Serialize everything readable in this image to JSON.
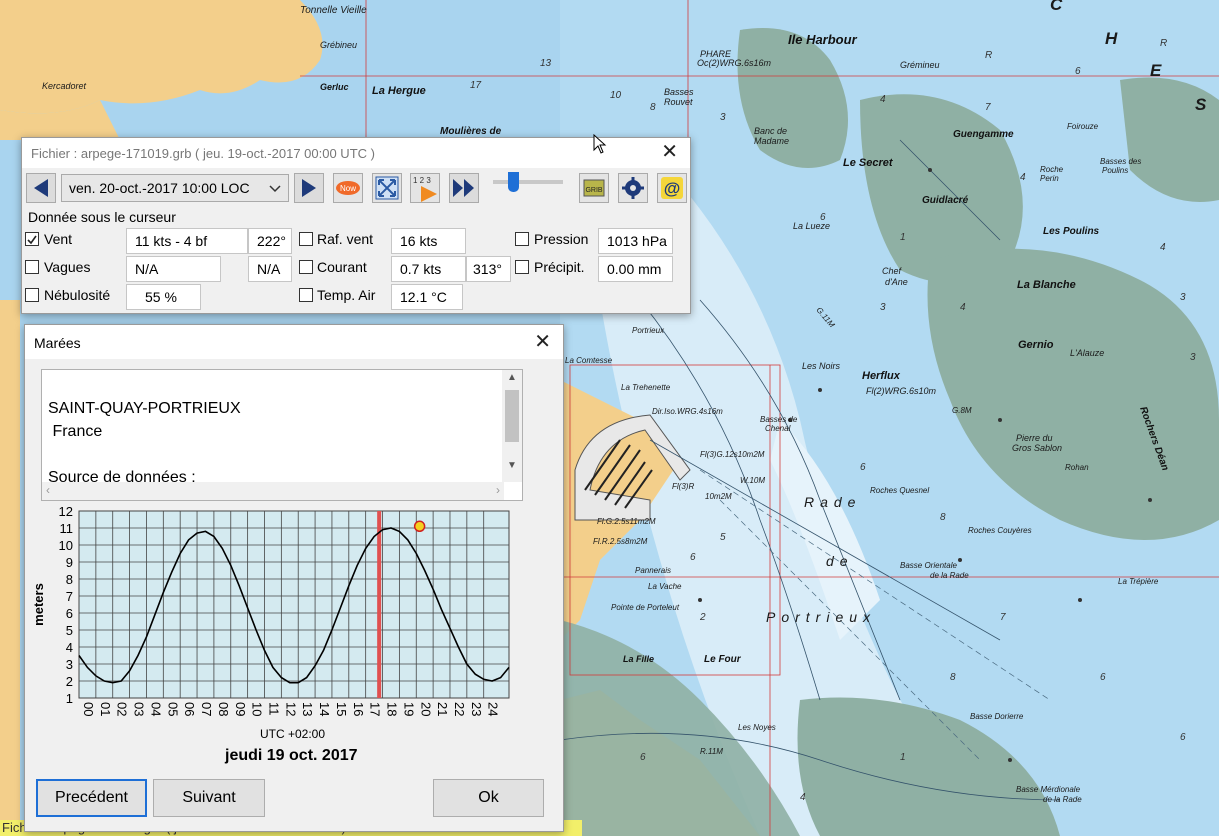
{
  "map": {
    "labels": [
      "Tonnelle Vieille",
      "Grébineu",
      "Kercadoret",
      "La Hergue",
      "Moulières de",
      "Ile Harbour",
      "PHARE",
      "Oc(2)WRG.6s16m",
      "Basses",
      "Rouvet",
      "Grémineu",
      "Banc de",
      "Madame",
      "Le Secret",
      "Guengamme",
      "Guidlacré",
      "Basses des",
      "Poulins",
      "Roche",
      "Perin",
      "La Lueze",
      "Les Poulins",
      "Chef",
      "d'Ane",
      "La Blanche",
      "Gernio",
      "L'Alauze",
      "Les Noirs",
      "Herflux",
      "Fl(2)WRG.6s10m",
      "Pierre du",
      "Gros Sablon",
      "Rohan",
      "Rochers Déan",
      "Basses de",
      "Chenal",
      "La Trehenette",
      "Dir.Iso.WRG.4s16m",
      "Fl(3)G.12s10m2M",
      "Fl(3)R",
      "10m2M",
      "Fl.G.2.5s11m2M",
      "Fl.R.2.5s8m2M",
      "Pannerais",
      "La Vache",
      "Pointe de Porteleut",
      "Rade",
      "de",
      "Portrieux",
      "Roches Quesnel",
      "Roches Couyères",
      "Basse Orientale",
      "de la Rade",
      "La Trépière",
      "La Fille",
      "Le Four",
      "Basse Dorierre",
      "Les Noyes",
      "Basse Mérdionale",
      "de la Rade",
      "Portrieux",
      "La Comtesse",
      "Gerluc",
      "Foirouze",
      "W.10M",
      "R.11M",
      "G.8M",
      "G.11M"
    ]
  },
  "statusbar": {
    "text": "Fichier : arpege-171019.grb ( jeu. 19-oct.-2017 00:00  UTC )"
  },
  "data_window": {
    "title": "Fichier : arpege-171019.grb ( jeu. 19-oct.-2017 00:00  UTC )",
    "date_select": "ven. 20-oct.-2017  10:00 LOC",
    "now_icon_text": "Now",
    "count_icon_text": "1 2 3",
    "slider_value": 0.08,
    "section_label": "Donnée sous le curseur",
    "rows": {
      "vent": {
        "label": "Vent",
        "checked": true,
        "value": "11 kts -  4 bf",
        "dir": "222°"
      },
      "vagues": {
        "label": "Vagues",
        "checked": false,
        "value": "N/A",
        "dir": "N/A"
      },
      "nebulosite": {
        "label": "Nébulosité",
        "checked": false,
        "value": "55 %"
      },
      "raf_vent": {
        "label": "Raf. vent",
        "checked": false,
        "value": "16 kts"
      },
      "courant": {
        "label": "Courant",
        "checked": false,
        "value": "0.7 kts",
        "dir": "313°"
      },
      "temp_air": {
        "label": "Temp. Air",
        "checked": false,
        "value": "12.1 °C"
      },
      "pression": {
        "label": "Pression",
        "checked": false,
        "value": "1013 hPa"
      },
      "precip": {
        "label": "Précipit.",
        "checked": false,
        "value": "0.00 mm"
      }
    }
  },
  "tide_window": {
    "title": "Marées",
    "text_lines": [
      "SAINT-QUAY-PORTRIEUX",
      " France",
      "",
      "Source de données :"
    ],
    "timezone_label": "UTC +02:00",
    "date_label": "jeudi 19 oct. 2017",
    "buttons": {
      "prev": "Precédent",
      "next": "Suivant",
      "ok": "Ok"
    }
  },
  "chart_data": {
    "type": "line",
    "ylabel": "meters",
    "xlabel": "UTC +02:00",
    "ylim": [
      1,
      12
    ],
    "xlim": [
      0,
      25.5
    ],
    "y_ticks": [
      "1",
      "2",
      "3",
      "4",
      "5",
      "6",
      "7",
      "8",
      "9",
      "10",
      "11",
      "12"
    ],
    "x_ticks": [
      "00",
      "01",
      "02",
      "03",
      "04",
      "05",
      "06",
      "07",
      "08",
      "09",
      "10",
      "11",
      "12",
      "13",
      "14",
      "15",
      "16",
      "17",
      "18",
      "19",
      "20",
      "21",
      "22",
      "23",
      "24"
    ],
    "series": [
      {
        "x": [
          0,
          0.5,
          1,
          1.5,
          2,
          2.5,
          3,
          3.5,
          4,
          4.5,
          5,
          5.5,
          6,
          6.5,
          7,
          7.5,
          8,
          8.5,
          9,
          9.5,
          10,
          10.5,
          11,
          11.5,
          12,
          12.5,
          13,
          13.5,
          14,
          14.5,
          15,
          15.5,
          16,
          16.5,
          17,
          17.5,
          18,
          18.5,
          19,
          19.5,
          20,
          20.5,
          21,
          21.5,
          22,
          22.5,
          23,
          23.5,
          24,
          24.5,
          25,
          25.5
        ],
        "values": [
          3.5,
          2.8,
          2.3,
          2.0,
          1.9,
          2.0,
          2.6,
          3.5,
          4.6,
          5.9,
          7.2,
          8.4,
          9.5,
          10.3,
          10.7,
          10.8,
          10.5,
          9.8,
          8.8,
          7.6,
          6.3,
          5.0,
          3.8,
          2.8,
          2.2,
          1.9,
          1.9,
          2.2,
          2.9,
          3.8,
          5.0,
          6.3,
          7.6,
          8.8,
          9.8,
          10.5,
          10.9,
          11.0,
          10.8,
          10.3,
          9.5,
          8.5,
          7.4,
          6.2,
          5.1,
          4.0,
          3.0,
          2.4,
          2.1,
          2.0,
          2.2,
          2.8
        ]
      }
    ],
    "current_time_marker_x": 17.8,
    "highlight_point": {
      "x": 20.2,
      "y": 11.1
    },
    "grid": true,
    "colors": {
      "plot_bg": "#d4eaf0",
      "grid": "#444444",
      "line": "#000000",
      "marker": "#e05050",
      "highlight_fill": "#f5d020"
    }
  }
}
